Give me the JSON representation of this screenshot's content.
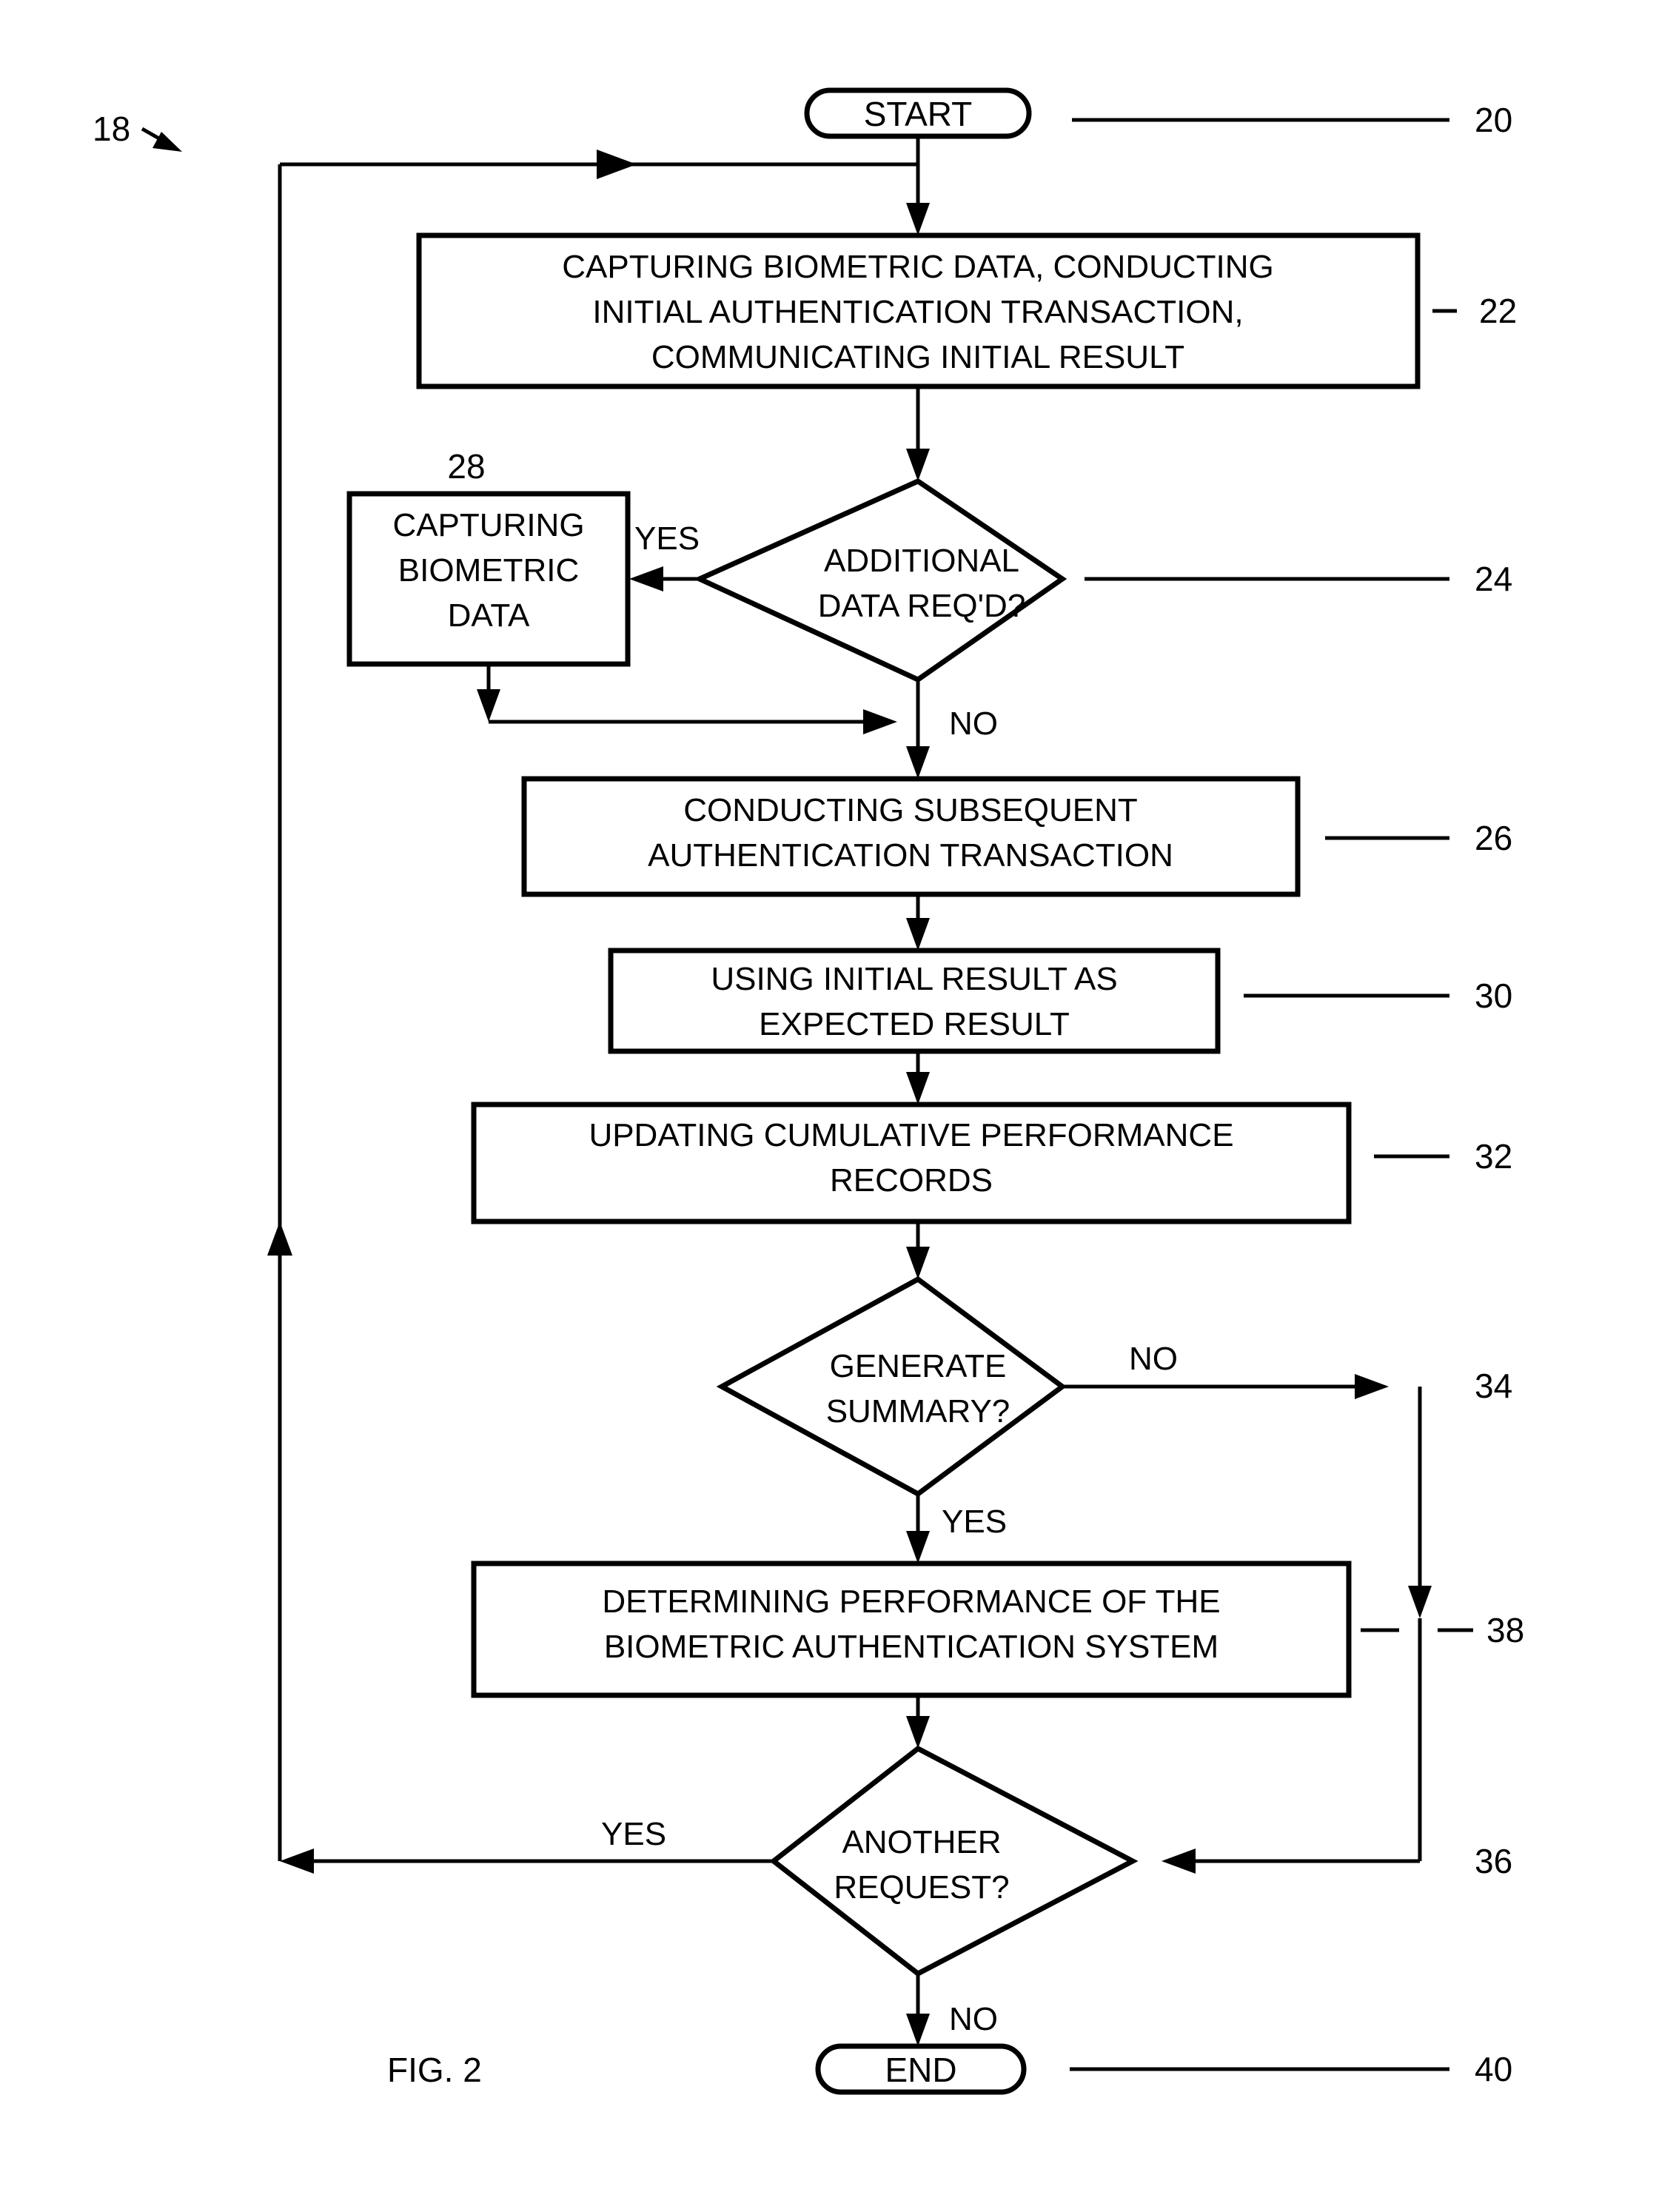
{
  "figure": {
    "caption": "FIG. 2",
    "system_ref": "18"
  },
  "nodes": {
    "start": {
      "label": "START",
      "ref": "20"
    },
    "capture_initial": {
      "lines": [
        "CAPTURING BIOMETRIC DATA, CONDUCTING",
        "INITIAL AUTHENTICATION TRANSACTION,",
        "COMMUNICATING INITIAL RESULT"
      ],
      "ref": "22"
    },
    "additional_data_decision": {
      "lines": [
        "ADDITIONAL",
        "DATA REQ'D?"
      ],
      "ref": "24"
    },
    "capturing_biometric_data": {
      "lines": [
        "CAPTURING",
        "BIOMETRIC",
        "DATA"
      ],
      "ref": "28"
    },
    "subsequent_transaction": {
      "lines": [
        "CONDUCTING SUBSEQUENT",
        "AUTHENTICATION TRANSACTION"
      ],
      "ref": "26"
    },
    "expected_result": {
      "lines": [
        "USING INITIAL RESULT AS",
        "EXPECTED RESULT"
      ],
      "ref": "30"
    },
    "updating_records": {
      "lines": [
        "UPDATING CUMULATIVE PERFORMANCE",
        "RECORDS"
      ],
      "ref": "32"
    },
    "generate_summary_decision": {
      "lines": [
        "GENERATE",
        "SUMMARY?"
      ],
      "ref": "34"
    },
    "determining_performance": {
      "lines": [
        "DETERMINING PERFORMANCE OF THE",
        "BIOMETRIC AUTHENTICATION SYSTEM"
      ],
      "ref": "38"
    },
    "another_request_decision": {
      "lines": [
        "ANOTHER",
        "REQUEST?"
      ],
      "ref": "36"
    },
    "end": {
      "label": "END",
      "ref": "40"
    }
  },
  "branch_labels": {
    "additional_yes": "YES",
    "additional_no": "NO",
    "summary_no": "NO",
    "summary_yes": "YES",
    "request_yes": "YES",
    "request_no": "NO"
  },
  "colors": {
    "ink": "#000000",
    "paper": "#ffffff"
  }
}
